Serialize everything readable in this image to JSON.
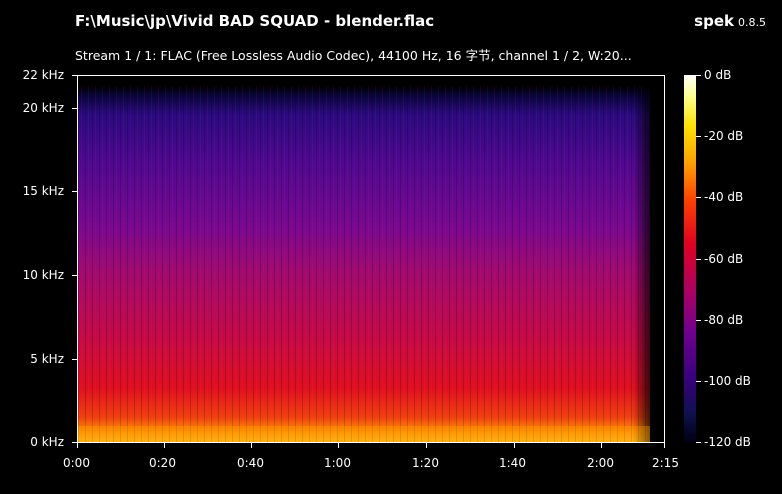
{
  "window": {
    "title": "F:\\Music\\jp\\Vivid BAD SQUAD - blender.flac",
    "brand_name": "spek",
    "brand_version": "0.8.5",
    "stream_info": "Stream 1 / 1: FLAC (Free Lossless Audio Codec), 44100 Hz, 16 字节, channel 1 / 2, W:20..."
  },
  "frequency_axis": {
    "ticks": [
      "22 kHz",
      "20 kHz",
      "15 kHz",
      "10 kHz",
      "5 kHz",
      "0 kHz"
    ]
  },
  "time_axis": {
    "ticks": [
      "0:00",
      "0:20",
      "0:40",
      "1:00",
      "1:20",
      "1:40",
      "2:00",
      "2:15"
    ]
  },
  "db_scale": {
    "ticks": [
      "0 dB",
      "-20 dB",
      "-40 dB",
      "-60 dB",
      "-80 dB",
      "-100 dB",
      "-120 dB"
    ]
  },
  "colors": {
    "background": "#000000",
    "text": "#ffffff"
  }
}
